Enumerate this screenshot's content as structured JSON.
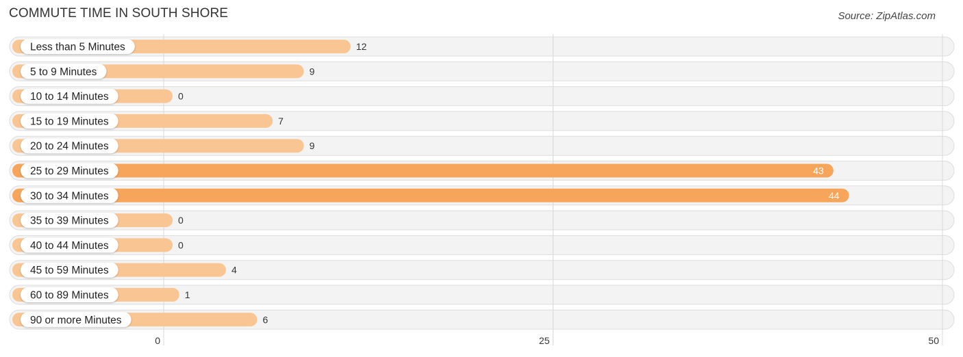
{
  "header": {
    "title": "COMMUTE TIME IN SOUTH SHORE",
    "source": "Source: ZipAtlas.com"
  },
  "colors": {
    "bar_light": "#f9c593",
    "bar_highlight": "#f6a55a",
    "track": "#f3f3f3",
    "track_border": "#dddddd",
    "grid": "#d8d8d8"
  },
  "chart_data": {
    "type": "bar",
    "orientation": "horizontal",
    "title": "COMMUTE TIME IN SOUTH SHORE",
    "xlabel": "",
    "ylabel": "",
    "xlim": [
      0,
      50
    ],
    "xticks": [
      0,
      25,
      50
    ],
    "grid": true,
    "categories": [
      "Less than 5 Minutes",
      "5 to 9 Minutes",
      "10 to 14 Minutes",
      "15 to 19 Minutes",
      "20 to 24 Minutes",
      "25 to 29 Minutes",
      "30 to 34 Minutes",
      "35 to 39 Minutes",
      "40 to 44 Minutes",
      "45 to 59 Minutes",
      "60 to 89 Minutes",
      "90 or more Minutes"
    ],
    "values": [
      12,
      9,
      0,
      7,
      9,
      43,
      44,
      0,
      0,
      4,
      1,
      6
    ],
    "highlighted": [
      false,
      false,
      false,
      false,
      false,
      true,
      true,
      false,
      false,
      false,
      false,
      false
    ]
  }
}
